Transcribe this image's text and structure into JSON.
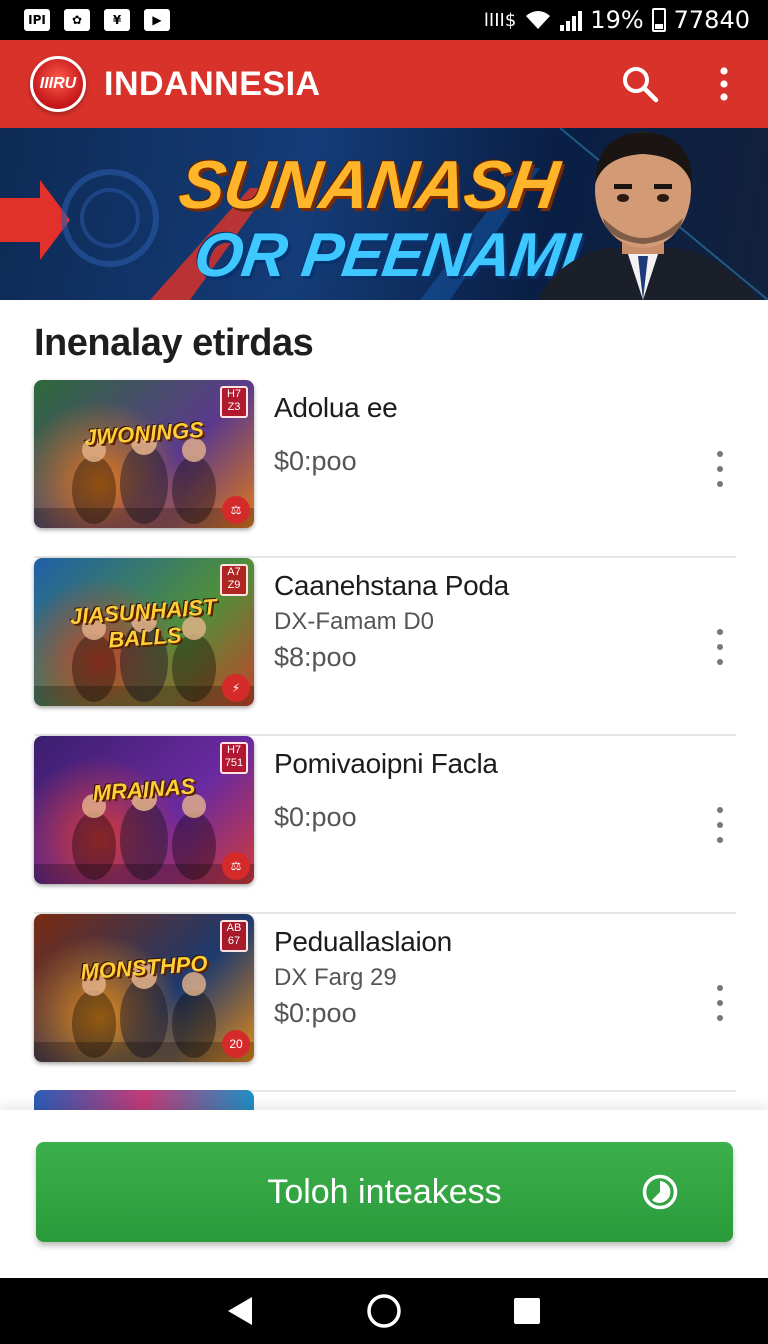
{
  "status_bar": {
    "left_icons": [
      "IPI",
      "✿",
      "¥",
      "▶"
    ],
    "carrier": "lIII$",
    "battery_percent": "19%",
    "time": "77840"
  },
  "app_bar": {
    "logo_text": "IIIRU",
    "title": "INDANNESIA",
    "icons": [
      "search-icon",
      "more-vert-icon"
    ]
  },
  "banner": {
    "line1": "SUNANASH",
    "line2": "OR PEENAMI"
  },
  "section": {
    "title": "Inenalay etirdas"
  },
  "items": [
    {
      "thumb_title": "JWONINGS",
      "thumb_colors": [
        "#2c6a3a",
        "#5b3a8c",
        "#e07a1a"
      ],
      "badge": "H7 Z3",
      "corner": "⚖",
      "name": "Adolua ee",
      "sub": "",
      "price": "$0:poo"
    },
    {
      "thumb_title": "JIASUNHAIST BALLS",
      "thumb_colors": [
        "#1e5fa8",
        "#4f8f3a",
        "#c4432a"
      ],
      "badge": "A7 Z9",
      "corner": "⚡",
      "name": "Caanehstana Poda",
      "sub": "DX-Famam D0",
      "price": "$8:poo"
    },
    {
      "thumb_title": "MRAINAS",
      "thumb_colors": [
        "#3b1e6e",
        "#6a2aa0",
        "#d23a3a"
      ],
      "badge": "H7 751",
      "corner": "⚖",
      "name": "Pomivaoipni Facla",
      "sub": "",
      "price": "$0:poo"
    },
    {
      "thumb_title": "MONSTHPO",
      "thumb_colors": [
        "#7a2a10",
        "#1e3a6e",
        "#e28a1a"
      ],
      "badge": "AB 67",
      "corner": "20",
      "name": "Peduallaslaion",
      "sub": "DX Farg 29",
      "price": "$0:poo"
    }
  ],
  "cta": {
    "label": "Toloh inteakess",
    "color": "#2fa23f"
  },
  "nav_bar": {
    "icons": [
      "back-icon",
      "home-icon",
      "recents-icon"
    ]
  },
  "colors": {
    "app_bar": "#d8322a",
    "banner_gold": "#ffb52a",
    "banner_blue": "#3ec8ff"
  }
}
